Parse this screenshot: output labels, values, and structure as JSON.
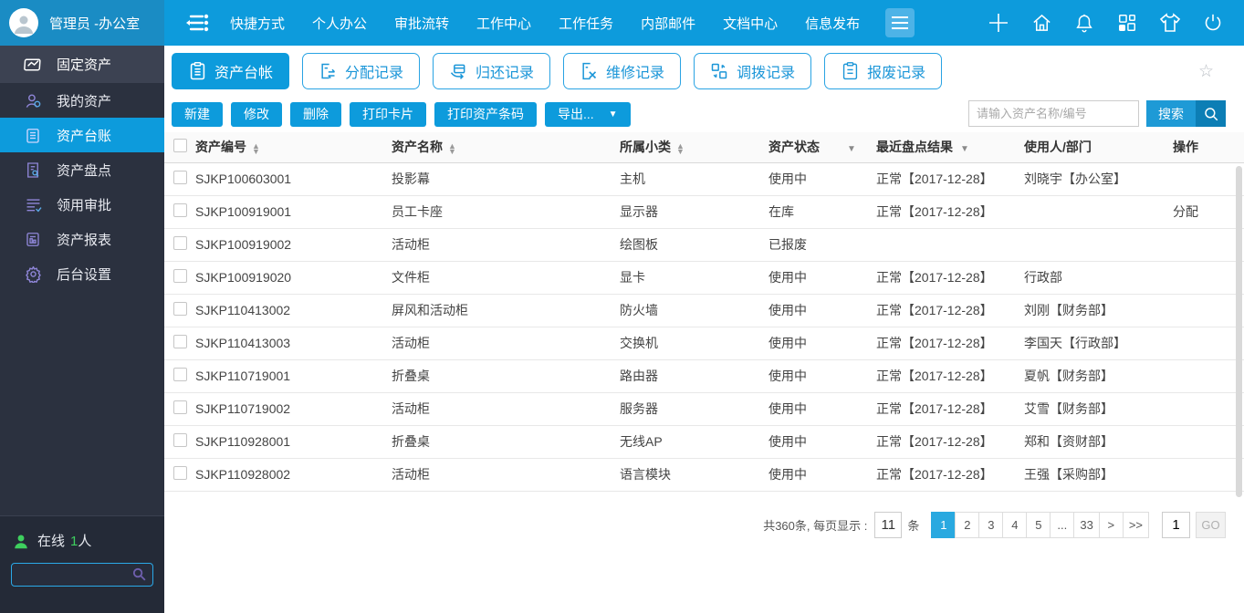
{
  "topbar": {
    "user_name": "管理员 -办公室",
    "menu": [
      "快捷方式",
      "个人办公",
      "审批流转",
      "工作中心",
      "工作任务",
      "内部邮件",
      "文档中心",
      "信息发布"
    ],
    "action_icons": [
      "plus",
      "home",
      "bell",
      "apps",
      "theme",
      "power"
    ]
  },
  "sidebar": {
    "module": "固定资产",
    "items": [
      {
        "label": "我的资产",
        "icon": "user",
        "active": false
      },
      {
        "label": "资产台账",
        "icon": "ledger",
        "active": true
      },
      {
        "label": "资产盘点",
        "icon": "inventory",
        "active": false
      },
      {
        "label": "领用审批",
        "icon": "approval",
        "active": false
      },
      {
        "label": "资产报表",
        "icon": "report",
        "active": false
      },
      {
        "label": "后台设置",
        "icon": "gear",
        "active": false
      }
    ],
    "online": {
      "prefix": "在线",
      "count": "1",
      "suffix": "人"
    }
  },
  "tabs": [
    {
      "label": "资产台帐",
      "icon": "clipboard",
      "active": true
    },
    {
      "label": "分配记录",
      "icon": "assign",
      "active": false
    },
    {
      "label": "归还记录",
      "icon": "return",
      "active": false
    },
    {
      "label": "维修记录",
      "icon": "repair",
      "active": false
    },
    {
      "label": "调拨记录",
      "icon": "transfer",
      "active": false
    },
    {
      "label": "报废记录",
      "icon": "scrap",
      "active": false
    }
  ],
  "toolbar": {
    "buttons": [
      "新建",
      "修改",
      "删除",
      "打印卡片",
      "打印资产条码"
    ],
    "export_label": "导出...",
    "search_placeholder": "请输入资产名称/编号",
    "search_label": "搜索"
  },
  "table": {
    "columns": [
      {
        "label": "资产编号",
        "icon": "sort"
      },
      {
        "label": "资产名称",
        "icon": "sort"
      },
      {
        "label": "所属小类",
        "icon": "sort"
      },
      {
        "label": "资产状态",
        "icon": "filter"
      },
      {
        "label": "最近盘点结果",
        "icon": "filter"
      },
      {
        "label": "使用人/部门",
        "icon": null
      },
      {
        "label": "操作",
        "icon": null
      }
    ],
    "rows": [
      {
        "code": "SJKP100603001",
        "name": "投影幕",
        "category": "主机",
        "status": "使用中",
        "check_result": "正常【2017-12-28】",
        "user": "刘晓宇【办公室】",
        "action": ""
      },
      {
        "code": "SJKP100919001",
        "name": "员工卡座",
        "category": "显示器",
        "status": "在库",
        "check_result": "正常【2017-12-28】",
        "user": "",
        "action": "分配"
      },
      {
        "code": "SJKP100919002",
        "name": "活动柜",
        "category": "绘图板",
        "status": "已报废",
        "check_result": "",
        "user": "",
        "action": ""
      },
      {
        "code": "SJKP100919020",
        "name": "文件柜",
        "category": "显卡",
        "status": "使用中",
        "check_result": "正常【2017-12-28】",
        "user": "行政部",
        "action": ""
      },
      {
        "code": "SJKP110413002",
        "name": "屏风和活动柜",
        "category": "防火墙",
        "status": "使用中",
        "check_result": "正常【2017-12-28】",
        "user": "刘刚【财务部】",
        "action": ""
      },
      {
        "code": "SJKP110413003",
        "name": "活动柜",
        "category": "交换机",
        "status": "使用中",
        "check_result": "正常【2017-12-28】",
        "user": "李国天【行政部】",
        "action": ""
      },
      {
        "code": "SJKP110719001",
        "name": "折叠桌",
        "category": "路由器",
        "status": "使用中",
        "check_result": "正常【2017-12-28】",
        "user": "夏帆【财务部】",
        "action": ""
      },
      {
        "code": "SJKP110719002",
        "name": "活动柜",
        "category": "服务器",
        "status": "使用中",
        "check_result": "正常【2017-12-28】",
        "user": "艾雪【财务部】",
        "action": ""
      },
      {
        "code": "SJKP110928001",
        "name": "折叠桌",
        "category": "无线AP",
        "status": "使用中",
        "check_result": "正常【2017-12-28】",
        "user": "郑和【资财部】",
        "action": ""
      },
      {
        "code": "SJKP110928002",
        "name": "活动柜",
        "category": "语言模块",
        "status": "使用中",
        "check_result": "正常【2017-12-28】",
        "user": "王强【采购部】",
        "action": ""
      }
    ]
  },
  "pagination": {
    "total_label": "共360条, 每页显示 :",
    "page_size": "11",
    "unit": "条",
    "pages": [
      "1",
      "2",
      "3",
      "4",
      "5",
      "...",
      "33"
    ],
    "active_page": "1",
    "next": ">",
    "last": ">>",
    "jump_value": "1",
    "go_label": "GO"
  },
  "colors": {
    "accent_blue": "#0d9bdc",
    "topbar_user_bg": "#1a8cc4",
    "sidebar_bg": "#2b313f",
    "sidebar_module_bg": "#3c4252",
    "online_green": "#3ecf5e",
    "pagination_active": "#29a9e0",
    "search_btn_dark": "#0c7eb5"
  }
}
